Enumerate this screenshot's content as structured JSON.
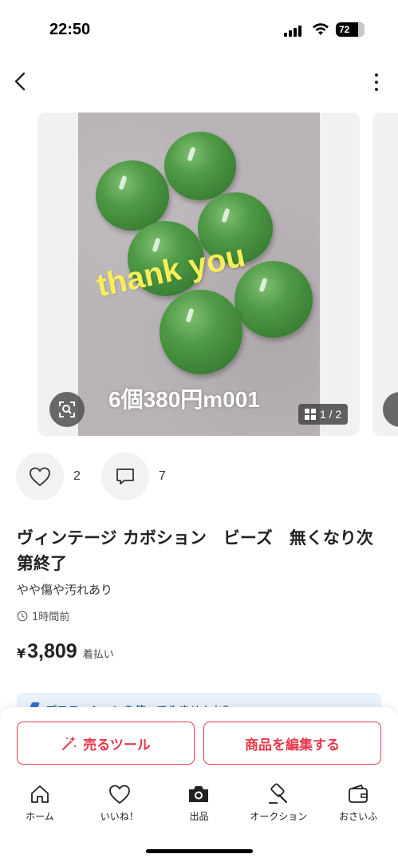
{
  "status_bar": {
    "time": "22:50",
    "battery": "72"
  },
  "nav": {
    "back_icon": "chevron-left-icon",
    "more_icon": "more-vertical-icon"
  },
  "gallery": {
    "caption_main": "thank you",
    "caption_sub": "6個380円m001",
    "page_counter": "1 / 2",
    "current_page": 1,
    "total_pages": 2
  },
  "actions": {
    "like_count": "2",
    "comment_count": "7"
  },
  "item": {
    "title": "ヴィンテージ カボション　ビーズ　無くなり次第終了",
    "condition": "やや傷や汚れあり",
    "posted": "1時間前",
    "currency": "¥",
    "price": "3,809",
    "shipping": "着払い"
  },
  "promo": {
    "text": "プロモーションを使ってみませんか？"
  },
  "bottom_actions": {
    "sell_tool": "売るツール",
    "edit": "商品を編集する"
  },
  "tabbar": [
    {
      "label": "ホーム",
      "icon": "home-icon"
    },
    {
      "label": "いいね！",
      "icon": "heart-icon"
    },
    {
      "label": "出品",
      "icon": "camera-icon"
    },
    {
      "label": "オークション",
      "icon": "auction-hammer-icon"
    },
    {
      "label": "おさいふ",
      "icon": "wallet-icon"
    }
  ],
  "colors": {
    "accent": "#e8384b",
    "bead_green": "#4f9a47",
    "caption_yellow": "#f7ee5a"
  }
}
